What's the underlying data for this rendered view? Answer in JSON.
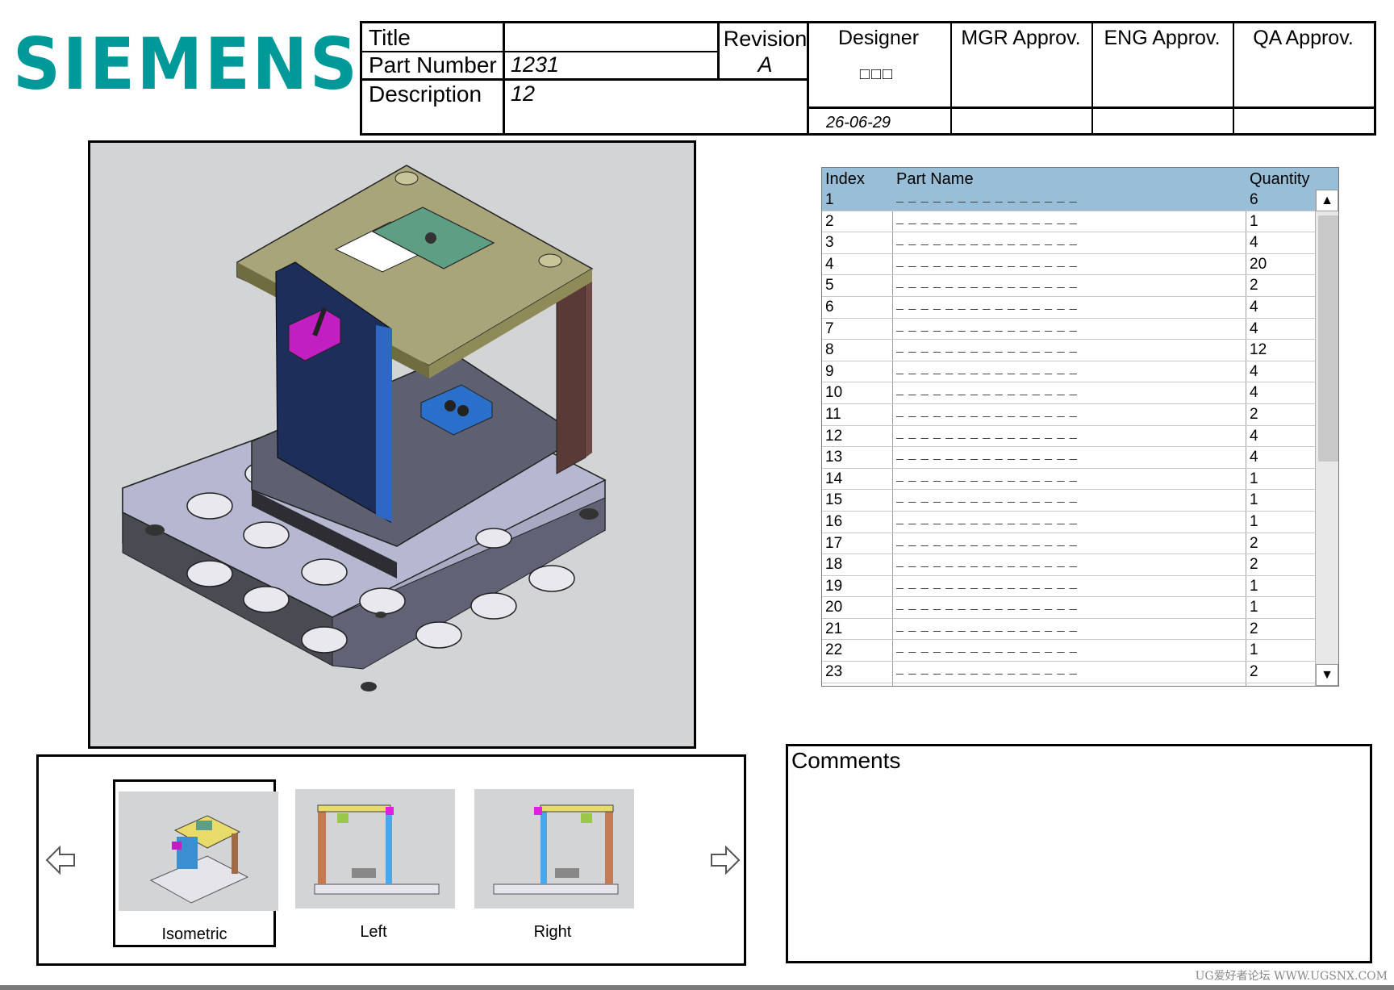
{
  "brand": "SIEMENS",
  "title_block": {
    "title_label": "Title",
    "title_value": "",
    "part_number_label": "Part Number",
    "part_number_value": "1231",
    "description_label": "Description",
    "description_value": "12",
    "revision_label": "Revision",
    "revision_value": "A",
    "designer_label": "Designer",
    "designer_name": "□□□",
    "designer_date": "26-06-29",
    "mgr_label": "MGR Approv.",
    "eng_label": "ENG Approv.",
    "qa_label": "QA Approv."
  },
  "parts_table": {
    "headers": {
      "index": "Index",
      "name": "Part Name",
      "quantity": "Quantity"
    },
    "rows": [
      {
        "index": "1",
        "name": "_ _ _ _ _ _ _ _ _ _ _ _ _ _ _",
        "qty": "6"
      },
      {
        "index": "2",
        "name": "_ _ _ _ _ _ _ _ _ _ _ _ _ _ _",
        "qty": "1"
      },
      {
        "index": "3",
        "name": "_ _ _ _ _ _ _ _ _ _ _ _ _ _ _",
        "qty": "4"
      },
      {
        "index": "4",
        "name": "_ _ _ _ _ _ _ _ _ _ _ _ _ _ _",
        "qty": "20"
      },
      {
        "index": "5",
        "name": "_ _ _ _ _ _ _ _ _ _ _ _ _ _ _",
        "qty": "2"
      },
      {
        "index": "6",
        "name": "_ _ _ _ _ _ _ _ _ _ _ _ _ _ _",
        "qty": "4"
      },
      {
        "index": "7",
        "name": "_ _ _ _ _ _ _ _ _ _ _ _ _ _ _",
        "qty": "4"
      },
      {
        "index": "8",
        "name": "_ _ _ _ _ _ _ _ _ _ _ _ _ _ _",
        "qty": "12"
      },
      {
        "index": "9",
        "name": "_ _ _ _ _ _ _ _ _ _ _ _ _ _ _",
        "qty": "4"
      },
      {
        "index": "10",
        "name": "_ _ _ _ _ _ _ _ _ _ _ _ _ _ _",
        "qty": "4"
      },
      {
        "index": "11",
        "name": "_ _ _ _ _ _ _ _ _ _ _ _ _ _ _",
        "qty": "2"
      },
      {
        "index": "12",
        "name": "_ _ _ _ _ _ _ _ _ _ _ _ _ _ _",
        "qty": "4"
      },
      {
        "index": "13",
        "name": "_ _ _ _ _ _ _ _ _ _ _ _ _ _ _",
        "qty": "4"
      },
      {
        "index": "14",
        "name": "_ _ _ _ _ _ _ _ _ _ _ _ _ _ _",
        "qty": "1"
      },
      {
        "index": "15",
        "name": "_ _ _ _ _ _ _ _ _ _ _ _ _ _ _",
        "qty": "1"
      },
      {
        "index": "16",
        "name": "_ _ _ _ _ _ _ _ _ _ _ _ _ _ _",
        "qty": "1"
      },
      {
        "index": "17",
        "name": "_ _ _ _ _ _ _ _ _ _ _ _ _ _ _",
        "qty": "2"
      },
      {
        "index": "18",
        "name": "_ _ _ _ _ _ _ _ _ _ _ _ _ _ _",
        "qty": "2"
      },
      {
        "index": "19",
        "name": "_ _ _ _ _ _ _ _ _ _ _ _ _ _ _",
        "qty": "1"
      },
      {
        "index": "20",
        "name": "_ _ _ _ _ _ _ _ _ _ _ _ _ _ _",
        "qty": "1"
      },
      {
        "index": "21",
        "name": "_ _ _ _ _ _ _ _ _ _ _ _ _ _ _",
        "qty": "2"
      },
      {
        "index": "22",
        "name": "_ _ _ _ _ _ _ _ _ _ _ _ _ _ _",
        "qty": "1"
      },
      {
        "index": "23",
        "name": "_ _ _ _ _ _ _ _ _ _ _ _ _ _ _",
        "qty": "2"
      }
    ],
    "selected_index": 0
  },
  "comments": {
    "label": "Comments"
  },
  "views": [
    {
      "label": "Isometric",
      "selected": true
    },
    {
      "label": "Left",
      "selected": false
    },
    {
      "label": "Right",
      "selected": false
    }
  ],
  "icons": {
    "prev": "arrow-left-icon",
    "next": "arrow-right-icon",
    "scroll_up": "triangle-up-icon",
    "scroll_down": "triangle-down-icon"
  },
  "colors": {
    "brand": "#009999",
    "header_bg": "#99bfd8"
  },
  "watermark": "UG爱好者论坛 WWW.UGSNX.COM"
}
